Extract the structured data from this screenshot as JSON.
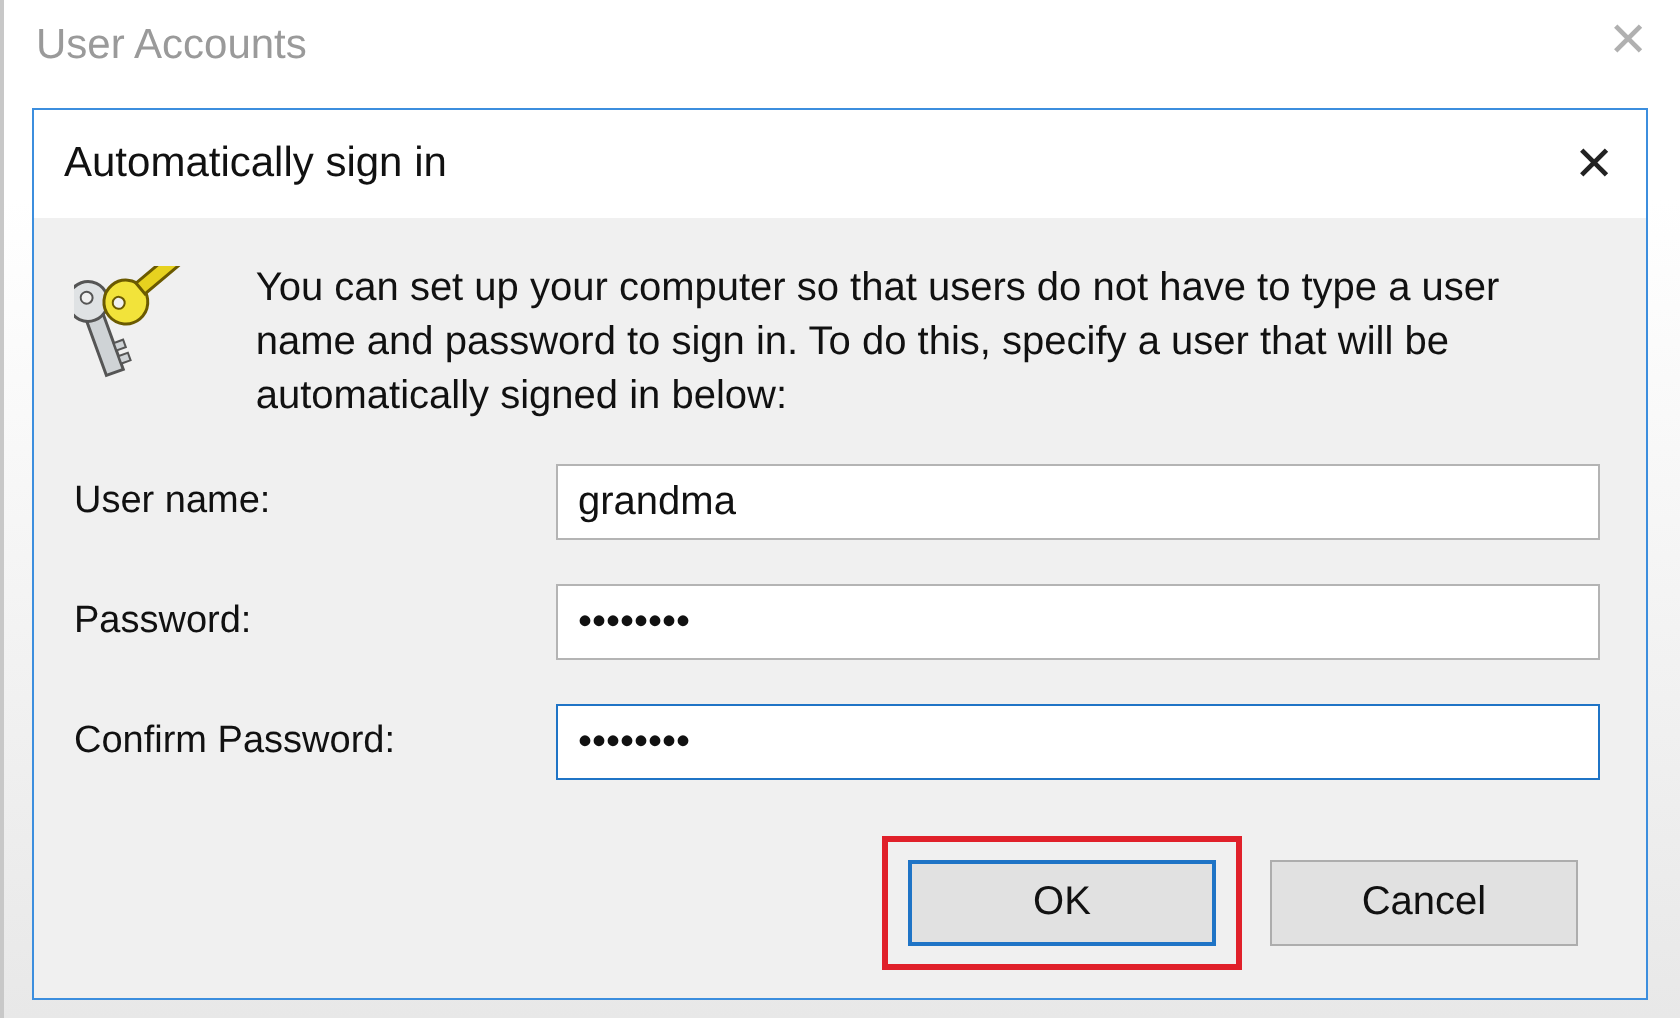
{
  "parent_window": {
    "title": "User Accounts",
    "close": "✕"
  },
  "dialog": {
    "title": "Automatically sign in",
    "close": "✕",
    "message": "You can set up your computer so that users do not have to type a user name and password to sign in. To do this, specify a user that will be automatically signed in below:",
    "fields": [
      {
        "label": "User name:",
        "value": "grandma",
        "focused": false
      },
      {
        "label": "Password:",
        "value": "••••••••",
        "focused": false
      },
      {
        "label": "Confirm Password:",
        "value": "••••••••",
        "focused": true
      }
    ],
    "buttons": [
      {
        "label": "OK",
        "default": true,
        "highlighted": true
      },
      {
        "label": "Cancel",
        "default": false,
        "highlighted": false
      }
    ]
  }
}
